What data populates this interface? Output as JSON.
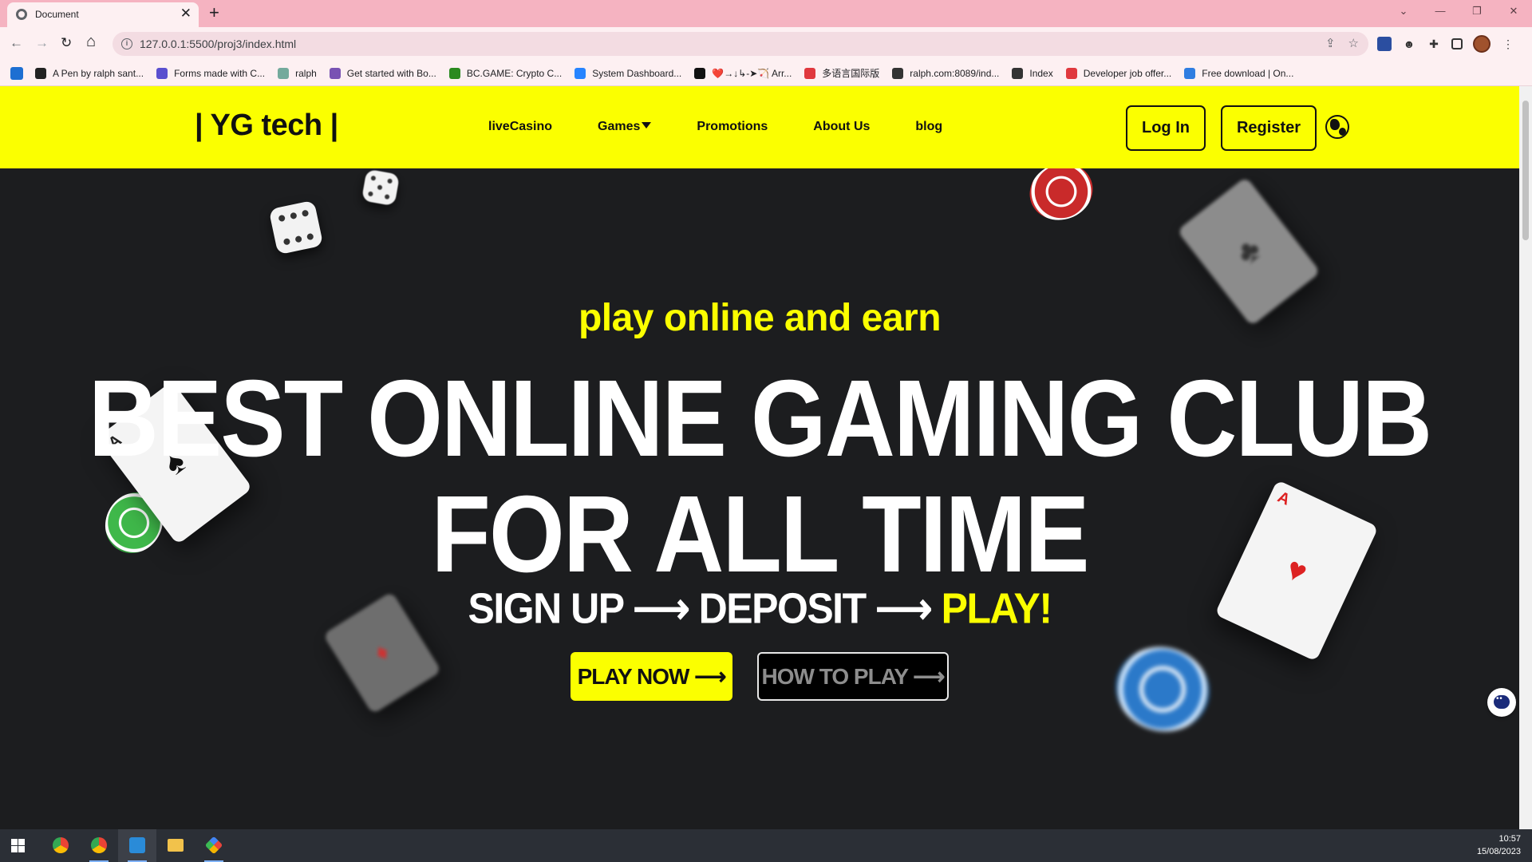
{
  "browser": {
    "tab_title": "Document",
    "tab_close": "✕",
    "new_tab": "+",
    "url": "127.0.0.1:5500/proj3/index.html",
    "nav": {
      "back": "←",
      "forward": "→",
      "reload": "↻",
      "home": "⌂"
    },
    "window_controls": [
      "⌄",
      "—",
      "❐",
      "✕"
    ],
    "omni_icons": [
      "⇪",
      "☆"
    ],
    "bookmarks": [
      {
        "label": "A Pen by ralph sant...",
        "color": "#222222"
      },
      {
        "label": "Forms made with C...",
        "color": "#5a4fcf"
      },
      {
        "label": "ralph",
        "color": "#74aa9c"
      },
      {
        "label": "Get started with Bo...",
        "color": "#7952b3"
      },
      {
        "label": "BC.GAME: Crypto C...",
        "color": "#2b8a1f"
      },
      {
        "label": "System Dashboard...",
        "color": "#2684ff"
      },
      {
        "label": "❤️→↓↳-➤🏹 Arr...",
        "color": "#111111"
      },
      {
        "label": "多语言国际版",
        "color": "#e0383e"
      },
      {
        "label": "ralph.com:8089/ind...",
        "color": "#333333"
      },
      {
        "label": "Index",
        "color": "#333333"
      },
      {
        "label": "Developer job offer...",
        "color": "#e0383e"
      },
      {
        "label": "Free download | On...",
        "color": "#2f7de1"
      }
    ]
  },
  "site": {
    "logo": "| YG tech |",
    "nav": [
      "liveCasino",
      "Games",
      "Promotions",
      "About Us",
      "blog"
    ],
    "login": "Log In",
    "register": "Register"
  },
  "hero": {
    "tagline": "play online and earn",
    "headline_1": "BEST ONLINE GAMING CLUB",
    "headline_2": "FOR ALL TIME",
    "steps_text": "SIGN UP ⟶ DEPOSIT ⟶ ",
    "steps_highlight": "PLAY!",
    "play_button": "PLAY NOW ⟶",
    "how_button": "HOW TO PLAY ⟶"
  },
  "taskbar": {
    "time": "10:57",
    "date": "15/08/2023"
  },
  "colors": {
    "accent_yellow": "#fbff00",
    "hero_bg": "#1c1d1f",
    "tab_strip": "#f5b3c1"
  }
}
